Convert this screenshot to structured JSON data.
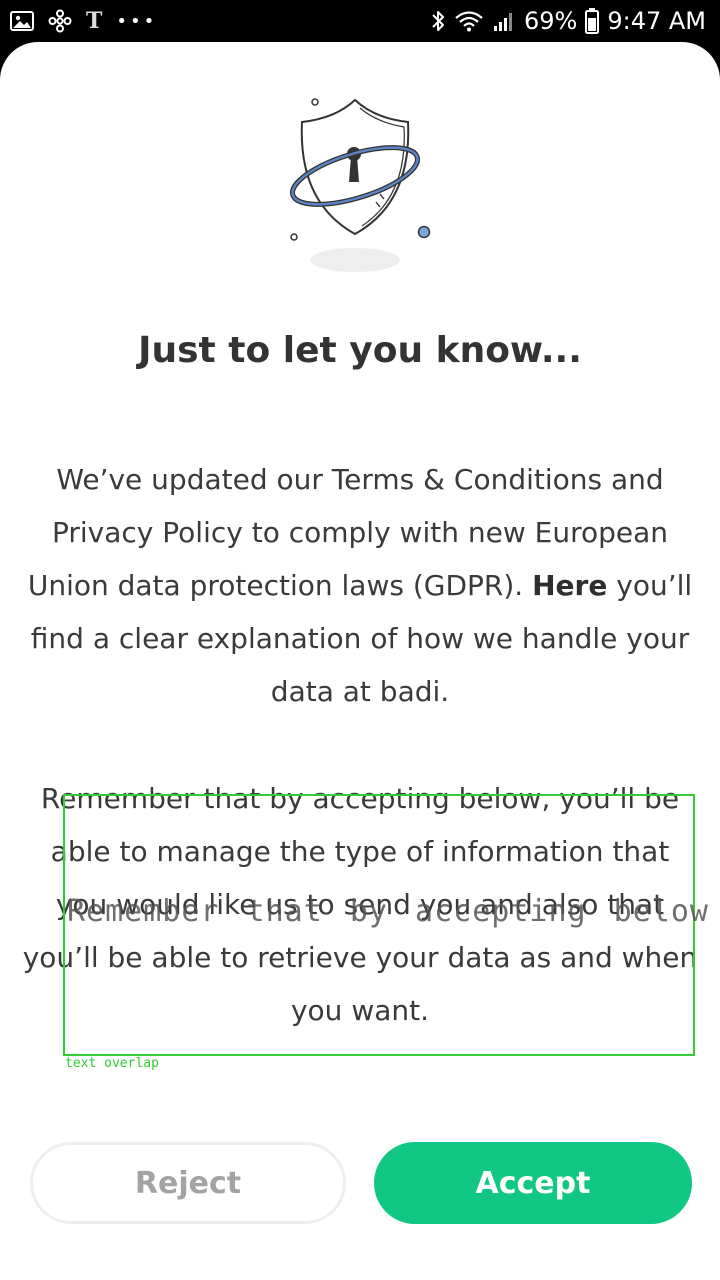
{
  "status_bar": {
    "battery_percent": "69%",
    "time": "9:47 AM",
    "notification_letter": "T",
    "more_indicator": "•••"
  },
  "dialog": {
    "title": "Just to let you know...",
    "paragraph1_before_link": "We’ve updated our Terms & Conditions and Privacy Policy to comply with new European Union data protection laws (GDPR). ",
    "paragraph1_link": "Here",
    "paragraph1_after_link": " you’ll find a clear explanation of how we handle your data at badi.",
    "paragraph2": "Remember that by accepting below, you’ll be able to manage the type of information that you would like us to send you and also that you’ll be able to retrieve your data as and when you want.",
    "reject_label": "Reject",
    "accept_label": "Accept"
  },
  "debug_overlay": {
    "label": "text overlap",
    "ghost_text": "Remember that by accepting below",
    "color": "#33cc33"
  },
  "colors": {
    "accent": "#10c784",
    "title": "#333333",
    "body_text": "#3a3a3a",
    "reject_text": "#a3a3a3"
  }
}
